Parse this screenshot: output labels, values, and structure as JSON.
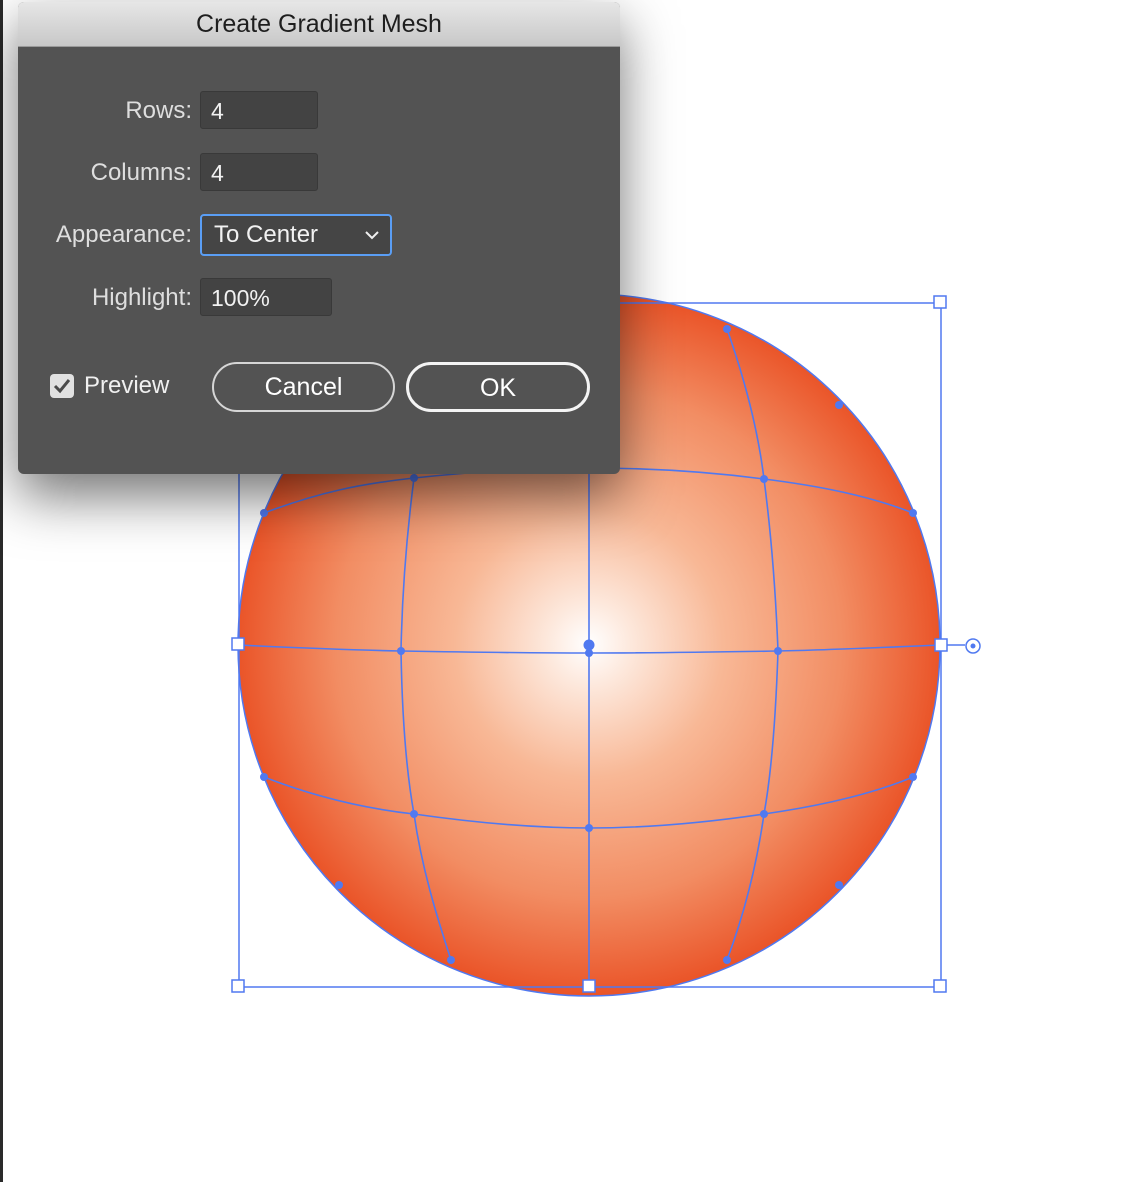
{
  "dialog": {
    "title": "Create Gradient Mesh",
    "rows": {
      "label": "Rows:",
      "value": "4"
    },
    "columns": {
      "label": "Columns:",
      "value": "4"
    },
    "appearance": {
      "label": "Appearance:",
      "value": "To Center"
    },
    "highlight": {
      "label": "Highlight:",
      "value": "100%"
    },
    "preview": {
      "label": "Preview",
      "checked": true
    },
    "cancel_label": "Cancel",
    "ok_label": "OK"
  },
  "colors": {
    "dialog_bg": "#535353",
    "selection_blue": "#5079f0",
    "sphere_edge": "#ec5a30",
    "sphere_highlight": "#ffffff"
  },
  "icons": [
    "chevron-down-icon",
    "checkmark-icon",
    "center-point-icon"
  ]
}
